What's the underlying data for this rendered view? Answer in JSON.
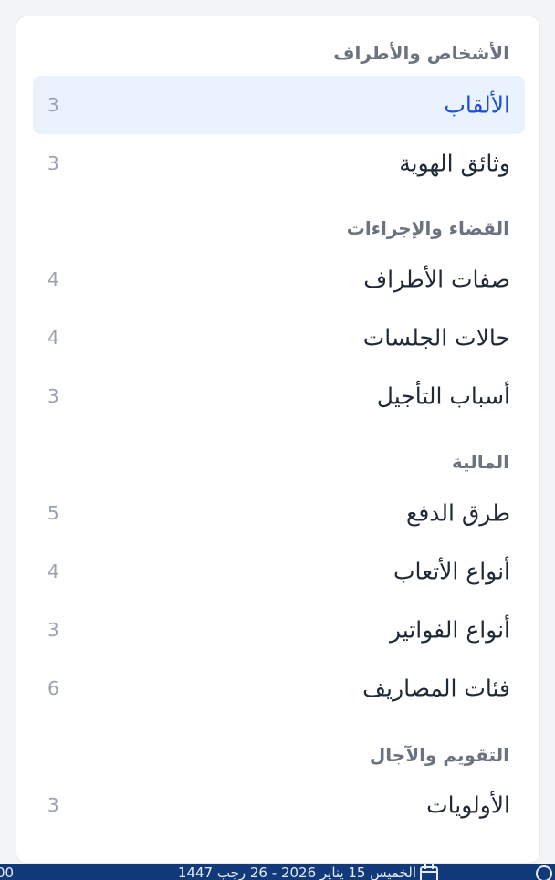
{
  "groups": [
    {
      "title": "الأشخاص والأطراف",
      "items": [
        {
          "label": "الألقاب",
          "count": "3"
        },
        {
          "label": "وثائق الهوية",
          "count": "3"
        }
      ]
    },
    {
      "title": "القضاء والإجراءات",
      "items": [
        {
          "label": "صفات الأطراف",
          "count": "4"
        },
        {
          "label": "حالات الجلسات",
          "count": "4"
        },
        {
          "label": "أسباب التأجيل",
          "count": "3"
        }
      ]
    },
    {
      "title": "المالية",
      "items": [
        {
          "label": "طرق الدفع",
          "count": "5"
        },
        {
          "label": "أنواع الأتعاب",
          "count": "4"
        },
        {
          "label": "أنواع الفواتير",
          "count": "3"
        },
        {
          "label": "فئات المصاريف",
          "count": "6"
        }
      ]
    },
    {
      "title": "التقويم والآجال",
      "items": [
        {
          "label": "الأولويات",
          "count": "3"
        }
      ]
    }
  ],
  "footer": {
    "date_text": "الخميس 15 يناير 2026 - 26 رجب 1447",
    "left_text": "00",
    "colors": {
      "bar": "#123a7a"
    }
  },
  "colors": {
    "active_row_bg": "#eaf2fd",
    "active_label": "#1d4ed8"
  }
}
